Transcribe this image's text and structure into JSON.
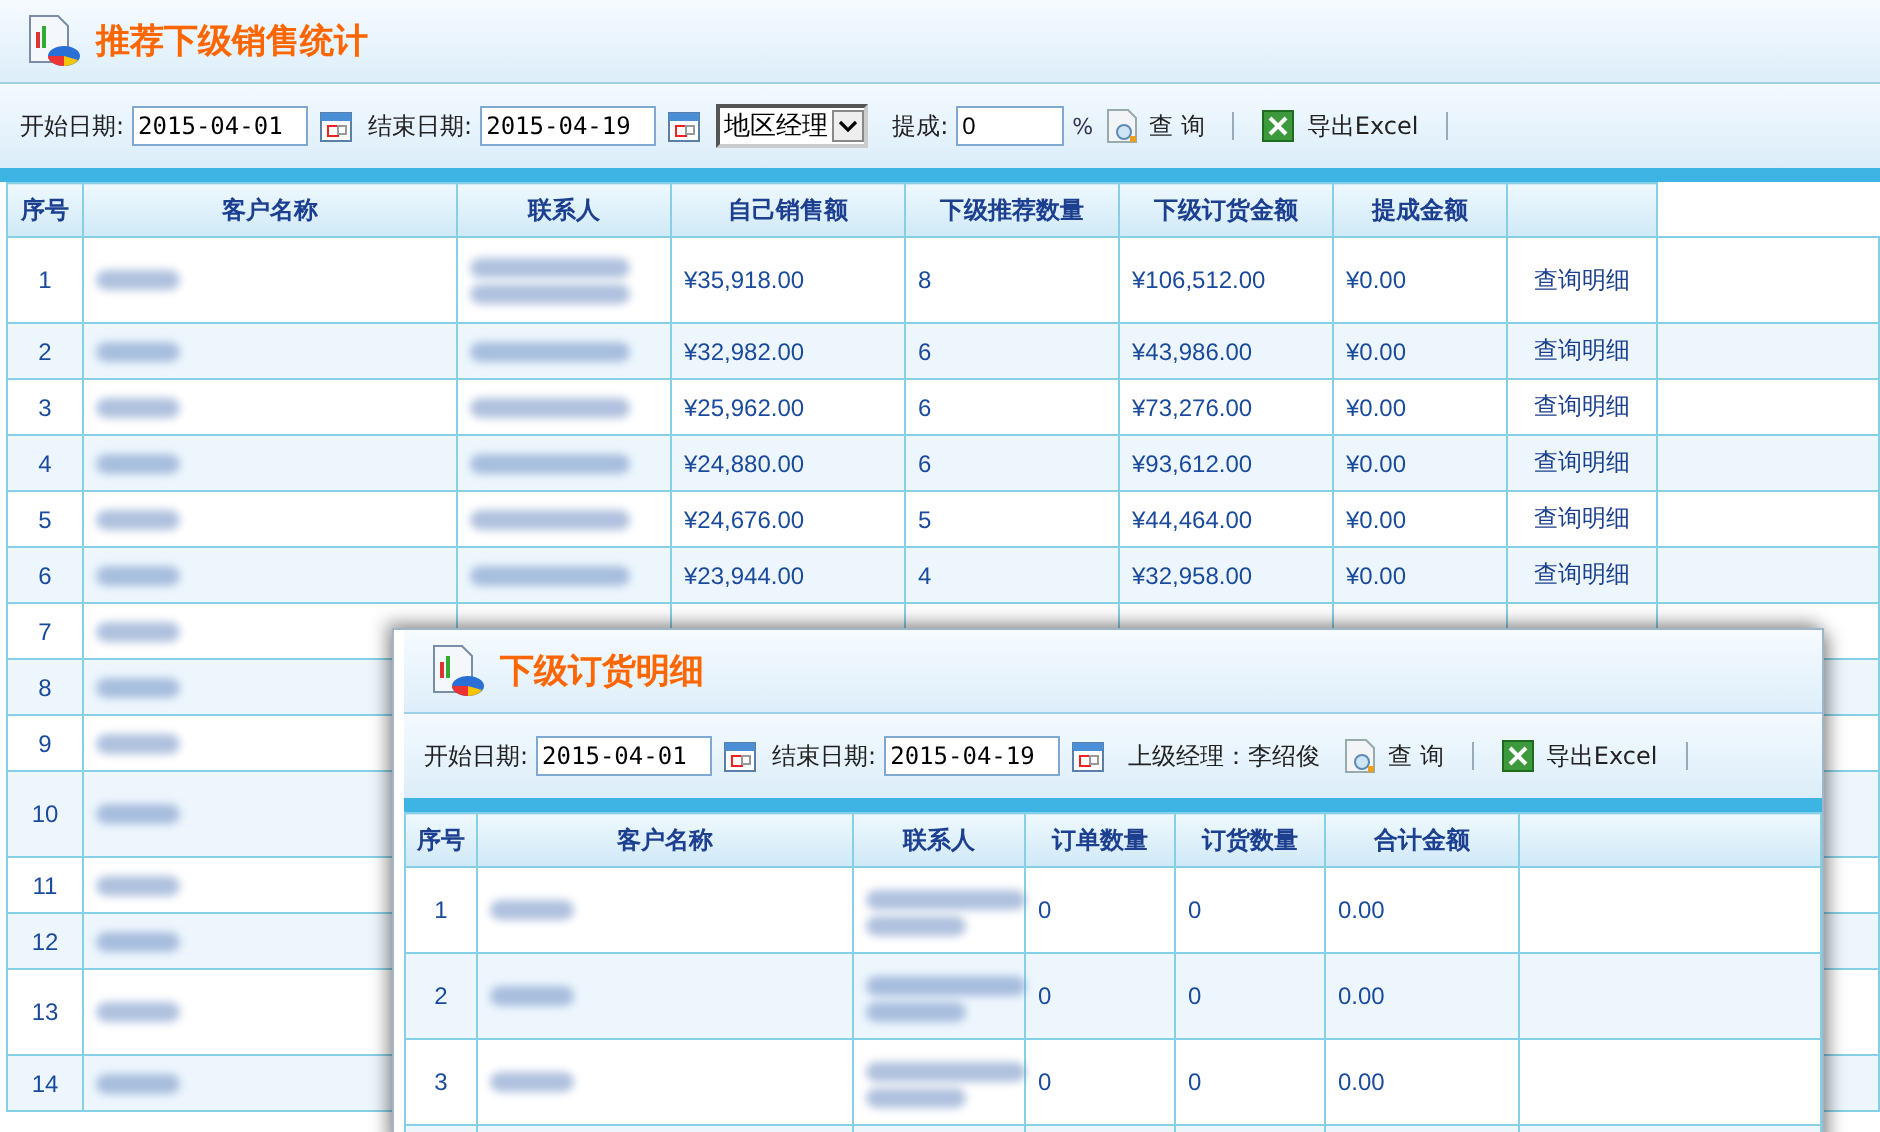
{
  "page": {
    "title": "推荐下级销售统计",
    "toolbar": {
      "start_label": "开始日期:",
      "start_value": "2015-04-01",
      "end_label": "结束日期:",
      "end_value": "2015-04-19",
      "role_value": "地区经理",
      "commission_label": "提成:",
      "commission_value": "0",
      "percent": "%",
      "query": "查 询",
      "export": "导出Excel"
    },
    "table": {
      "columns": [
        "序号",
        "客户名称",
        "联系人",
        "自己销售额",
        "下级推荐数量",
        "下级订货金额",
        "提成金额",
        ""
      ],
      "rows": [
        {
          "no": "1",
          "tall": true,
          "own_sales": "¥35,918.00",
          "sub_count": "8",
          "sub_orders": "¥106,512.00",
          "commission": "¥0.00",
          "detail": "查询明细"
        },
        {
          "no": "2",
          "tall": false,
          "own_sales": "¥32,982.00",
          "sub_count": "6",
          "sub_orders": "¥43,986.00",
          "commission": "¥0.00",
          "detail": "查询明细"
        },
        {
          "no": "3",
          "tall": false,
          "own_sales": "¥25,962.00",
          "sub_count": "6",
          "sub_orders": "¥73,276.00",
          "commission": "¥0.00",
          "detail": "查询明细"
        },
        {
          "no": "4",
          "tall": false,
          "own_sales": "¥24,880.00",
          "sub_count": "6",
          "sub_orders": "¥93,612.00",
          "commission": "¥0.00",
          "detail": "查询明细"
        },
        {
          "no": "5",
          "tall": false,
          "own_sales": "¥24,676.00",
          "sub_count": "5",
          "sub_orders": "¥44,464.00",
          "commission": "¥0.00",
          "detail": "查询明细"
        },
        {
          "no": "6",
          "tall": false,
          "own_sales": "¥23,944.00",
          "sub_count": "4",
          "sub_orders": "¥32,958.00",
          "commission": "¥0.00",
          "detail": "查询明细"
        },
        {
          "no": "7",
          "tall": false
        },
        {
          "no": "8",
          "tall": false
        },
        {
          "no": "9",
          "tall": false
        },
        {
          "no": "10",
          "tall": true
        },
        {
          "no": "11",
          "tall": false
        },
        {
          "no": "12",
          "tall": false
        },
        {
          "no": "13",
          "tall": true
        },
        {
          "no": "14",
          "tall": false
        }
      ]
    }
  },
  "dialog": {
    "title": "下级订货明细",
    "toolbar": {
      "start_label": "开始日期:",
      "start_value": "2015-04-01",
      "end_label": "结束日期:",
      "end_value": "2015-04-19",
      "manager": "上级经理：李绍俊",
      "query": "查 询",
      "export": "导出Excel"
    },
    "table": {
      "columns": [
        "序号",
        "客户名称",
        "联系人",
        "订单数量",
        "订货数量",
        "合计金额",
        ""
      ],
      "rows": [
        {
          "no": "1",
          "order_count": "0",
          "order_qty": "0",
          "total": "0.00"
        },
        {
          "no": "2",
          "order_count": "0",
          "order_qty": "0",
          "total": "0.00"
        },
        {
          "no": "3",
          "order_count": "0",
          "order_qty": "0",
          "total": "0.00"
        }
      ]
    }
  }
}
